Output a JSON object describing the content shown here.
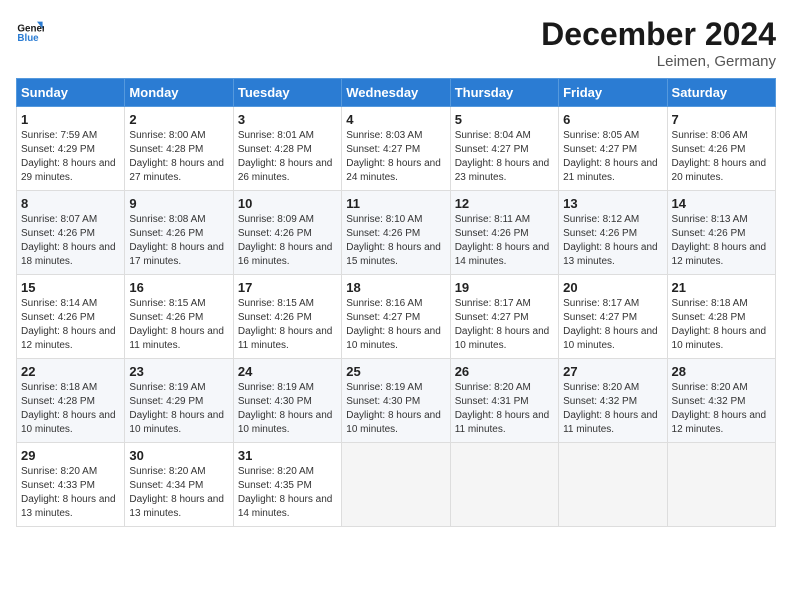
{
  "logo": {
    "line1": "General",
    "line2": "Blue"
  },
  "title": "December 2024",
  "subtitle": "Leimen, Germany",
  "days_header": [
    "Sunday",
    "Monday",
    "Tuesday",
    "Wednesday",
    "Thursday",
    "Friday",
    "Saturday"
  ],
  "weeks": [
    [
      {
        "day": "1",
        "sunrise": "Sunrise: 7:59 AM",
        "sunset": "Sunset: 4:29 PM",
        "daylight": "Daylight: 8 hours and 29 minutes."
      },
      {
        "day": "2",
        "sunrise": "Sunrise: 8:00 AM",
        "sunset": "Sunset: 4:28 PM",
        "daylight": "Daylight: 8 hours and 27 minutes."
      },
      {
        "day": "3",
        "sunrise": "Sunrise: 8:01 AM",
        "sunset": "Sunset: 4:28 PM",
        "daylight": "Daylight: 8 hours and 26 minutes."
      },
      {
        "day": "4",
        "sunrise": "Sunrise: 8:03 AM",
        "sunset": "Sunset: 4:27 PM",
        "daylight": "Daylight: 8 hours and 24 minutes."
      },
      {
        "day": "5",
        "sunrise": "Sunrise: 8:04 AM",
        "sunset": "Sunset: 4:27 PM",
        "daylight": "Daylight: 8 hours and 23 minutes."
      },
      {
        "day": "6",
        "sunrise": "Sunrise: 8:05 AM",
        "sunset": "Sunset: 4:27 PM",
        "daylight": "Daylight: 8 hours and 21 minutes."
      },
      {
        "day": "7",
        "sunrise": "Sunrise: 8:06 AM",
        "sunset": "Sunset: 4:26 PM",
        "daylight": "Daylight: 8 hours and 20 minutes."
      }
    ],
    [
      {
        "day": "8",
        "sunrise": "Sunrise: 8:07 AM",
        "sunset": "Sunset: 4:26 PM",
        "daylight": "Daylight: 8 hours and 18 minutes."
      },
      {
        "day": "9",
        "sunrise": "Sunrise: 8:08 AM",
        "sunset": "Sunset: 4:26 PM",
        "daylight": "Daylight: 8 hours and 17 minutes."
      },
      {
        "day": "10",
        "sunrise": "Sunrise: 8:09 AM",
        "sunset": "Sunset: 4:26 PM",
        "daylight": "Daylight: 8 hours and 16 minutes."
      },
      {
        "day": "11",
        "sunrise": "Sunrise: 8:10 AM",
        "sunset": "Sunset: 4:26 PM",
        "daylight": "Daylight: 8 hours and 15 minutes."
      },
      {
        "day": "12",
        "sunrise": "Sunrise: 8:11 AM",
        "sunset": "Sunset: 4:26 PM",
        "daylight": "Daylight: 8 hours and 14 minutes."
      },
      {
        "day": "13",
        "sunrise": "Sunrise: 8:12 AM",
        "sunset": "Sunset: 4:26 PM",
        "daylight": "Daylight: 8 hours and 13 minutes."
      },
      {
        "day": "14",
        "sunrise": "Sunrise: 8:13 AM",
        "sunset": "Sunset: 4:26 PM",
        "daylight": "Daylight: 8 hours and 12 minutes."
      }
    ],
    [
      {
        "day": "15",
        "sunrise": "Sunrise: 8:14 AM",
        "sunset": "Sunset: 4:26 PM",
        "daylight": "Daylight: 8 hours and 12 minutes."
      },
      {
        "day": "16",
        "sunrise": "Sunrise: 8:15 AM",
        "sunset": "Sunset: 4:26 PM",
        "daylight": "Daylight: 8 hours and 11 minutes."
      },
      {
        "day": "17",
        "sunrise": "Sunrise: 8:15 AM",
        "sunset": "Sunset: 4:26 PM",
        "daylight": "Daylight: 8 hours and 11 minutes."
      },
      {
        "day": "18",
        "sunrise": "Sunrise: 8:16 AM",
        "sunset": "Sunset: 4:27 PM",
        "daylight": "Daylight: 8 hours and 10 minutes."
      },
      {
        "day": "19",
        "sunrise": "Sunrise: 8:17 AM",
        "sunset": "Sunset: 4:27 PM",
        "daylight": "Daylight: 8 hours and 10 minutes."
      },
      {
        "day": "20",
        "sunrise": "Sunrise: 8:17 AM",
        "sunset": "Sunset: 4:27 PM",
        "daylight": "Daylight: 8 hours and 10 minutes."
      },
      {
        "day": "21",
        "sunrise": "Sunrise: 8:18 AM",
        "sunset": "Sunset: 4:28 PM",
        "daylight": "Daylight: 8 hours and 10 minutes."
      }
    ],
    [
      {
        "day": "22",
        "sunrise": "Sunrise: 8:18 AM",
        "sunset": "Sunset: 4:28 PM",
        "daylight": "Daylight: 8 hours and 10 minutes."
      },
      {
        "day": "23",
        "sunrise": "Sunrise: 8:19 AM",
        "sunset": "Sunset: 4:29 PM",
        "daylight": "Daylight: 8 hours and 10 minutes."
      },
      {
        "day": "24",
        "sunrise": "Sunrise: 8:19 AM",
        "sunset": "Sunset: 4:30 PM",
        "daylight": "Daylight: 8 hours and 10 minutes."
      },
      {
        "day": "25",
        "sunrise": "Sunrise: 8:19 AM",
        "sunset": "Sunset: 4:30 PM",
        "daylight": "Daylight: 8 hours and 10 minutes."
      },
      {
        "day": "26",
        "sunrise": "Sunrise: 8:20 AM",
        "sunset": "Sunset: 4:31 PM",
        "daylight": "Daylight: 8 hours and 11 minutes."
      },
      {
        "day": "27",
        "sunrise": "Sunrise: 8:20 AM",
        "sunset": "Sunset: 4:32 PM",
        "daylight": "Daylight: 8 hours and 11 minutes."
      },
      {
        "day": "28",
        "sunrise": "Sunrise: 8:20 AM",
        "sunset": "Sunset: 4:32 PM",
        "daylight": "Daylight: 8 hours and 12 minutes."
      }
    ],
    [
      {
        "day": "29",
        "sunrise": "Sunrise: 8:20 AM",
        "sunset": "Sunset: 4:33 PM",
        "daylight": "Daylight: 8 hours and 13 minutes."
      },
      {
        "day": "30",
        "sunrise": "Sunrise: 8:20 AM",
        "sunset": "Sunset: 4:34 PM",
        "daylight": "Daylight: 8 hours and 13 minutes."
      },
      {
        "day": "31",
        "sunrise": "Sunrise: 8:20 AM",
        "sunset": "Sunset: 4:35 PM",
        "daylight": "Daylight: 8 hours and 14 minutes."
      },
      null,
      null,
      null,
      null
    ]
  ]
}
